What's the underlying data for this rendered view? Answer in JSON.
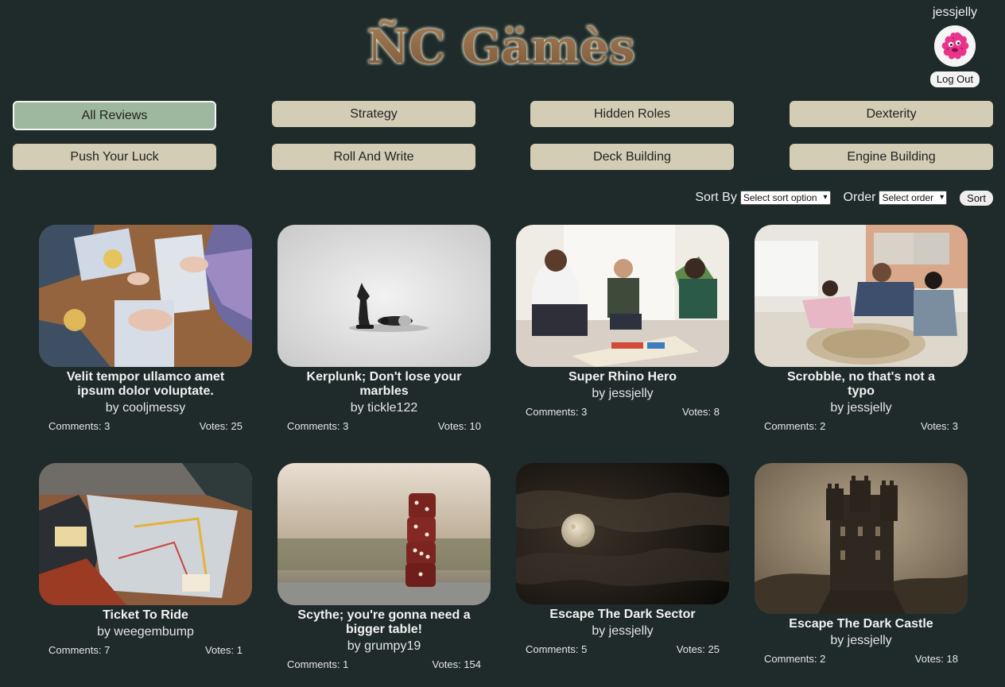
{
  "header": {
    "logo_text": "ÑC Gämès",
    "username": "jessjelly",
    "logout_label": "Log Out"
  },
  "categories": [
    {
      "label": "All Reviews",
      "active": true
    },
    {
      "label": "Strategy",
      "active": false
    },
    {
      "label": "Hidden Roles",
      "active": false
    },
    {
      "label": "Dexterity",
      "active": false
    },
    {
      "label": "Push Your Luck",
      "active": false
    },
    {
      "label": "Roll And Write",
      "active": false
    },
    {
      "label": "Deck Building",
      "active": false
    },
    {
      "label": "Engine Building",
      "active": false
    }
  ],
  "sort": {
    "sort_by_label": "Sort By",
    "sort_by_value": "Select sort option",
    "order_label": "Order",
    "order_value": "Select order",
    "button_label": "Sort"
  },
  "reviews": [
    {
      "title": "Velit tempor ullamco amet ipsum dolor voluptate.",
      "author": "by cooljmessy",
      "comments": "Comments: 3",
      "votes": "Votes: 25",
      "image": "people-playing-board-game-on-wooden-table"
    },
    {
      "title": "Kerplunk; Don't lose your marbles",
      "author": "by tickle122",
      "comments": "Comments: 3",
      "votes": "Votes: 10",
      "image": "chess-pieces-on-white"
    },
    {
      "title": "Super Rhino Hero",
      "author": "by jessjelly",
      "comments": "Comments: 3",
      "votes": "Votes: 8",
      "image": "family-playing-board-game-by-window"
    },
    {
      "title": "Scrobble, no that's not a typo",
      "author": "by jessjelly",
      "comments": "Comments: 2",
      "votes": "Votes: 3",
      "image": "family-playing-on-floor"
    },
    {
      "title": "Ticket To Ride",
      "author": "by weegembump",
      "comments": "Comments: 7",
      "votes": "Votes: 1",
      "image": "friends-playing-board-game-on-rug"
    },
    {
      "title": "Scythe; you're gonna need a bigger table!",
      "author": "by grumpy19",
      "comments": "Comments: 1",
      "votes": "Votes: 154",
      "image": "stacked-red-dice"
    },
    {
      "title": "Escape The Dark Sector",
      "author": "by jessjelly",
      "comments": "Comments: 5",
      "votes": "Votes: 25",
      "image": "moon-behind-clouds"
    },
    {
      "title": "Escape The Dark Castle",
      "author": "by jessjelly",
      "comments": "Comments: 2",
      "votes": "Votes: 18",
      "image": "old-castle-sepia"
    }
  ]
}
